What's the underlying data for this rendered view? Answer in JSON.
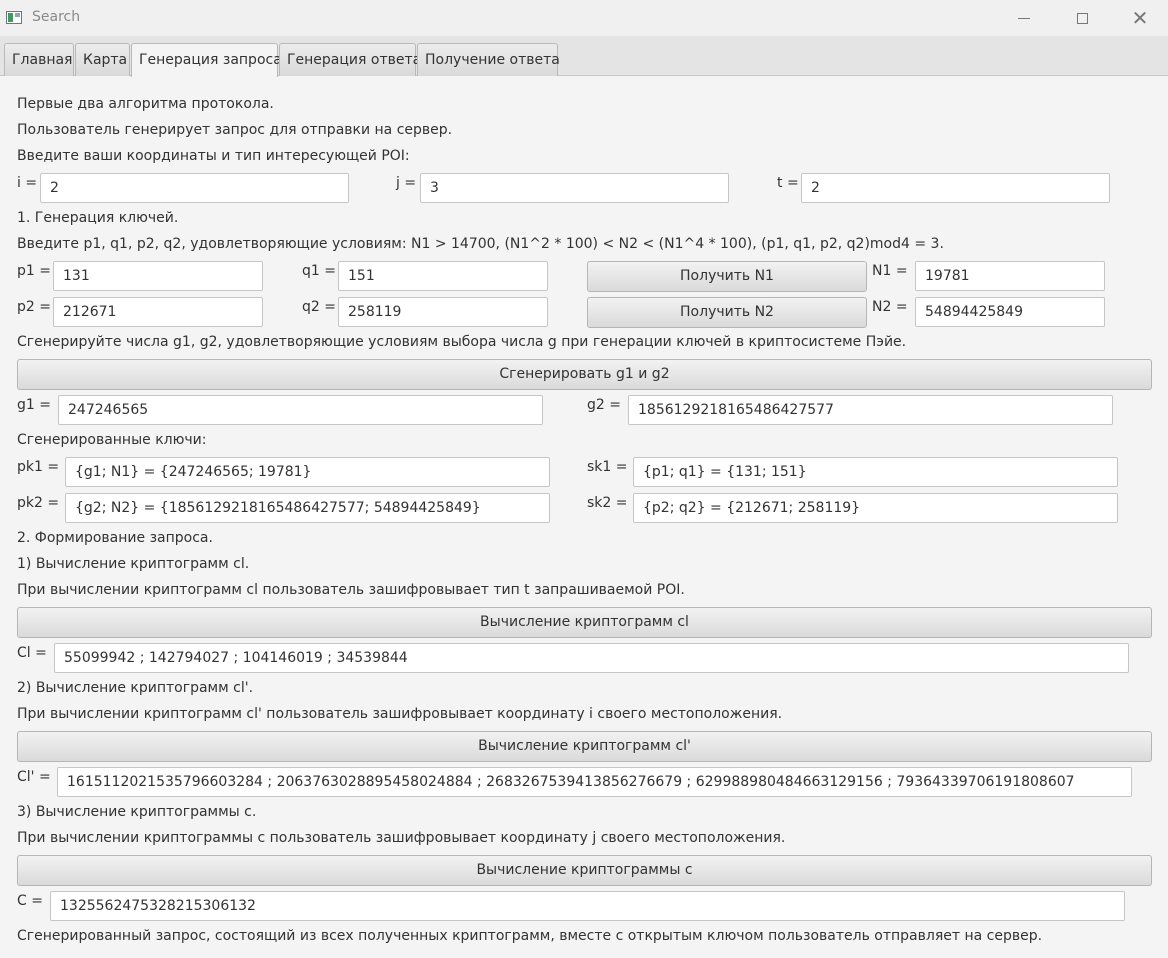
{
  "window": {
    "title": "Search"
  },
  "tabs": [
    "Главная",
    "Карта",
    "Генерация запроса",
    "Генерация ответа",
    "Получение ответа"
  ],
  "intro": [
    "Первые два алгоритма протокола.",
    "Пользователь генерирует запрос для отправки на сервер.",
    "Введите ваши координаты и тип интересующей POI:"
  ],
  "coords": {
    "i_label": "i =",
    "i_value": "2",
    "j_label": "j =",
    "j_value": "3",
    "t_label": "t =",
    "t_value": "2"
  },
  "keygen": {
    "heading": "1. Генерация ключей.",
    "condition": "Введите p1, q1, p2, q2, удовлетворяющие условиям: N1 > 14700, (N1^2 * 100) < N2 < (N1^4 * 100), (p1, q1, p2, q2)mod4 = 3.",
    "p1_label": "p1 =",
    "p1_value": "131",
    "q1_label": "q1 =",
    "q1_value": "151",
    "p2_label": "p2 =",
    "p2_value": "212671",
    "q2_label": "q2 =",
    "q2_value": "258119",
    "get_n1_label": "Получить N1",
    "get_n2_label": "Получить N2",
    "n1_label": "N1 =",
    "n1_value": "19781",
    "n2_label": "N2 =",
    "n2_value": "54894425849",
    "g_instruction": "Сгенерируйте числа g1, g2, удовлетворяющие условиям выбора числа g при генерации ключей в криптосистеме Пэйе.",
    "gen_g_label": "Сгенерировать g1 и g2",
    "g1_label": "g1 =",
    "g1_value": "247246565",
    "g2_label": "g2 =",
    "g2_value": "1856129218165486427577",
    "keys_heading": "Сгенерированные ключи:",
    "pk1_label": "pk1 =",
    "pk1_value": "{g1; N1} = {247246565; 19781}",
    "pk2_label": "pk2 =",
    "pk2_value": "{g2; N2} = {1856129218165486427577; 54894425849}",
    "sk1_label": "sk1 =",
    "sk1_value": "{p1; q1} = {131; 151}",
    "sk2_label": "sk2 =",
    "sk2_value": "{p2; q2} = {212671; 258119}"
  },
  "request": {
    "heading": "2. Формирование запроса.",
    "cl_heading": "1) Вычисление криптограмм cl.",
    "cl_desc": "При вычислении криптограмм cl пользователь зашифровывает тип t запрашиваемой POI.",
    "cl_button": "Вычисление криптограмм cl",
    "cl_label": "Cl =",
    "cl_value": "55099942 ; 142794027 ; 104146019 ; 34539844",
    "clp_heading": "2) Вычисление криптограмм cl'.",
    "clp_desc": "При вычислении криптограмм cl' пользователь зашифровывает координату i своего местоположения.",
    "clp_button": "Вычисление криптограмм cl'",
    "clp_label": "Cl' =",
    "clp_value": "1615112021535796603284 ; 2063763028895458024884 ; 2683267539413856276679 ; 629988980484663129156 ; 793643397061918086​07",
    "c_heading": "3) Вычисление криптограммы c.",
    "c_desc": "При вычислении криптограммы c пользователь зашифровывает координату j своего местоположения.",
    "c_button": "Вычисление криптограммы c",
    "c_label": "C =",
    "c_value": "1325562475328215306132",
    "final_text": "Сгенерированный запрос, состоящий из всех полученных криптограмм, вместе с открытым ключом пользователь отправляет на сервер."
  }
}
